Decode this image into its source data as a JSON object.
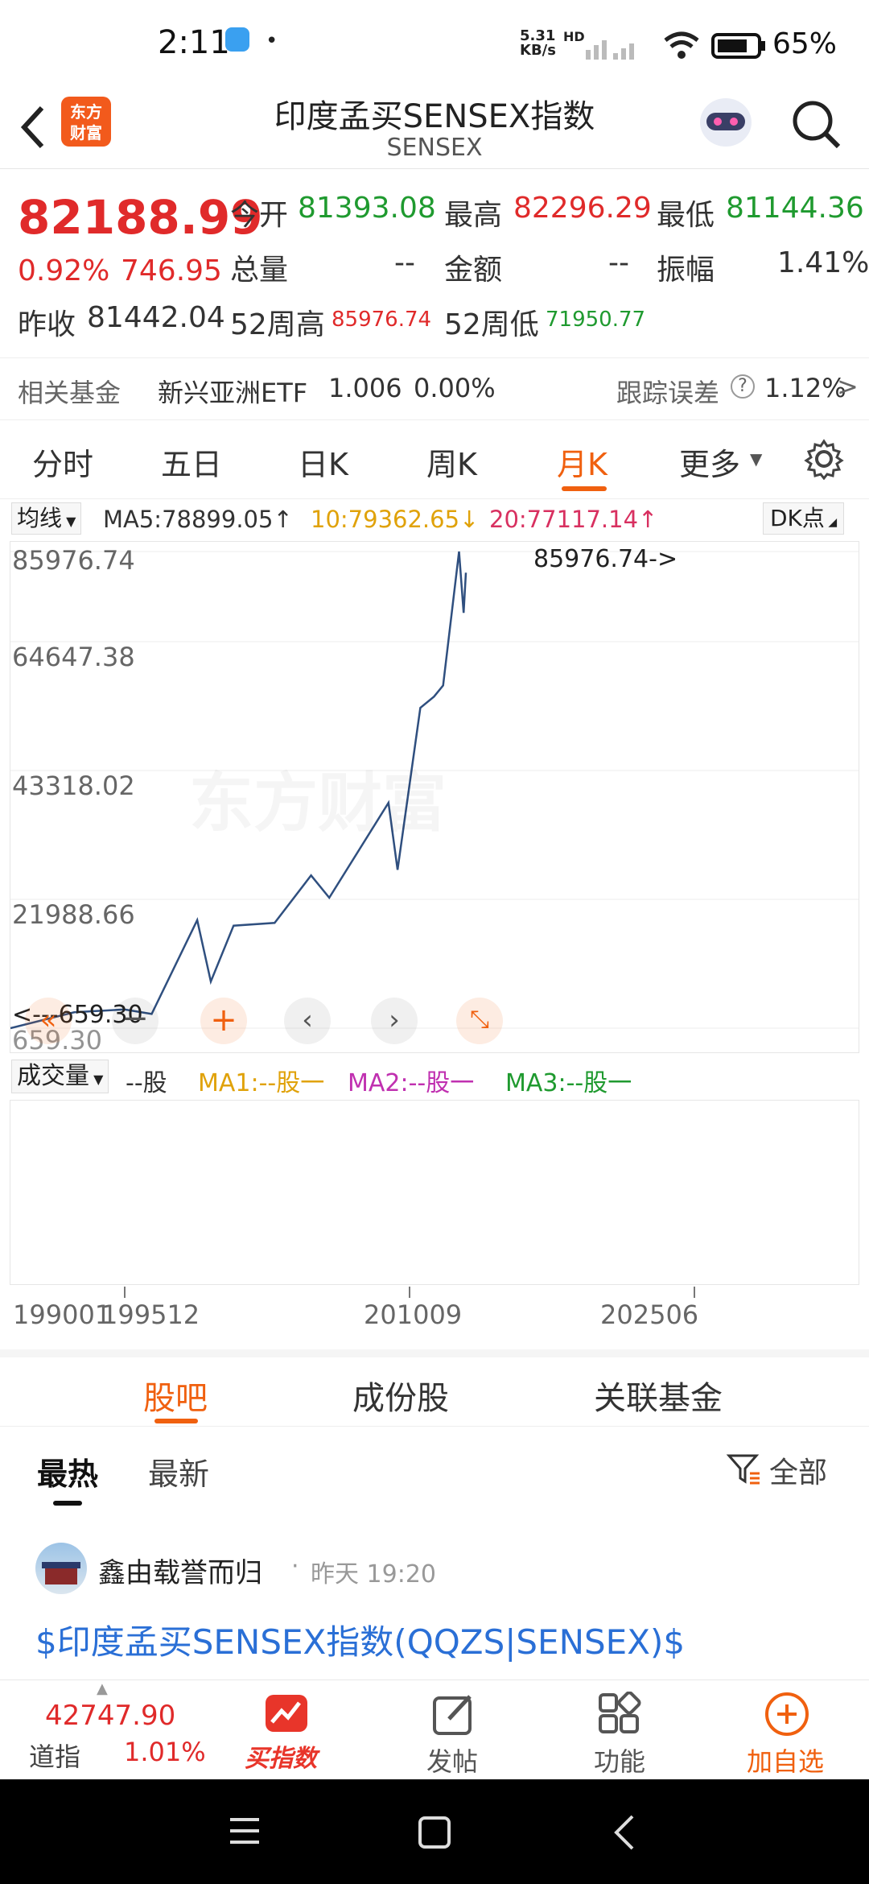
{
  "status_bar": {
    "time": "2:11",
    "net_speed_top": "5.31",
    "net_speed_bottom": "KB/s",
    "hd": "HD",
    "battery": "65%"
  },
  "header": {
    "title": "印度孟买SENSEX指数",
    "subtitle": "SENSEX",
    "logo_line1": "东方",
    "logo_line2": "财富"
  },
  "quote": {
    "price": "82188.99",
    "change_pct": "0.92%",
    "change": "746.95",
    "prev_close_label": "昨收",
    "prev_close": "81442.04",
    "open_label": "今开",
    "open": "81393.08",
    "high_label": "最高",
    "high": "82296.29",
    "low_label": "最低",
    "low": "81144.36",
    "volume_label": "总量",
    "volume": "--",
    "amount_label": "金额",
    "amount": "--",
    "amplitude_label": "振幅",
    "amplitude": "1.41%",
    "wk52_high_label": "52周高",
    "wk52_high": "85976.74",
    "wk52_low_label": "52周低",
    "wk52_low": "71950.77"
  },
  "fund": {
    "label": "相关基金",
    "name": "新兴亚洲ETF",
    "price": "1.006",
    "change": "0.00%",
    "track_label": "跟踪误差",
    "track_value": "1.12%",
    "arrow": ">"
  },
  "ktabs": {
    "items": [
      "分时",
      "五日",
      "日K",
      "周K",
      "月K",
      "更多"
    ],
    "active": "月K"
  },
  "ma_bar": {
    "selector": "均线",
    "ma5": "MA5:78899.05",
    "ma10": "10:79362.65",
    "ma20": "20:77117.14",
    "dk": "DK点"
  },
  "chart": {
    "y_labels": [
      "85976.74",
      "64647.38",
      "43318.02",
      "21988.66",
      "659.30"
    ],
    "max_marker": "85976.74->",
    "min_marker": "<---659.30",
    "watermark": "东方财富",
    "line_color": "#2f4f7f"
  },
  "vol_bar": {
    "selector": "成交量",
    "unit": "--股",
    "ma1": "MA1:--股",
    "ma2": "MA2:--股",
    "ma3": "MA3:--股"
  },
  "x_axis": {
    "labels": [
      "199001",
      "199512",
      "201009",
      "202506"
    ]
  },
  "chart_data": {
    "type": "line",
    "x": [
      "199001",
      "1995",
      "2000",
      "2003",
      "2007",
      "2008",
      "2010",
      "2013",
      "2015",
      "2016",
      "2020-02",
      "2020-03",
      "2021",
      "2022",
      "2023",
      "2024-09",
      "2025-01",
      "2025-06"
    ],
    "values": [
      659.3,
      3500,
      4000,
      3200,
      20000,
      9000,
      19000,
      19500,
      28000,
      24000,
      41000,
      29000,
      58000,
      60000,
      62000,
      85976.74,
      75000,
      82188.99
    ],
    "ylim": [
      659.3,
      85976.74
    ]
  },
  "bar_tabs": {
    "items": [
      "股吧",
      "成份股",
      "关联基金"
    ],
    "active": "股吧"
  },
  "sub_tabs": {
    "hot": "最热",
    "new": "最新",
    "filter": "全部"
  },
  "post": {
    "user": "鑫由载誉而归",
    "time": "昨天 19:20",
    "content": "$印度孟买SENSEX指数(QQZS|SENSEX)$"
  },
  "bottom_nav": {
    "dow_value": "42747.90",
    "dow_label": "道指",
    "dow_change": "1.01%",
    "buy_index": "买指数",
    "post": "发帖",
    "functions": "功能",
    "add_watch": "加自选"
  }
}
